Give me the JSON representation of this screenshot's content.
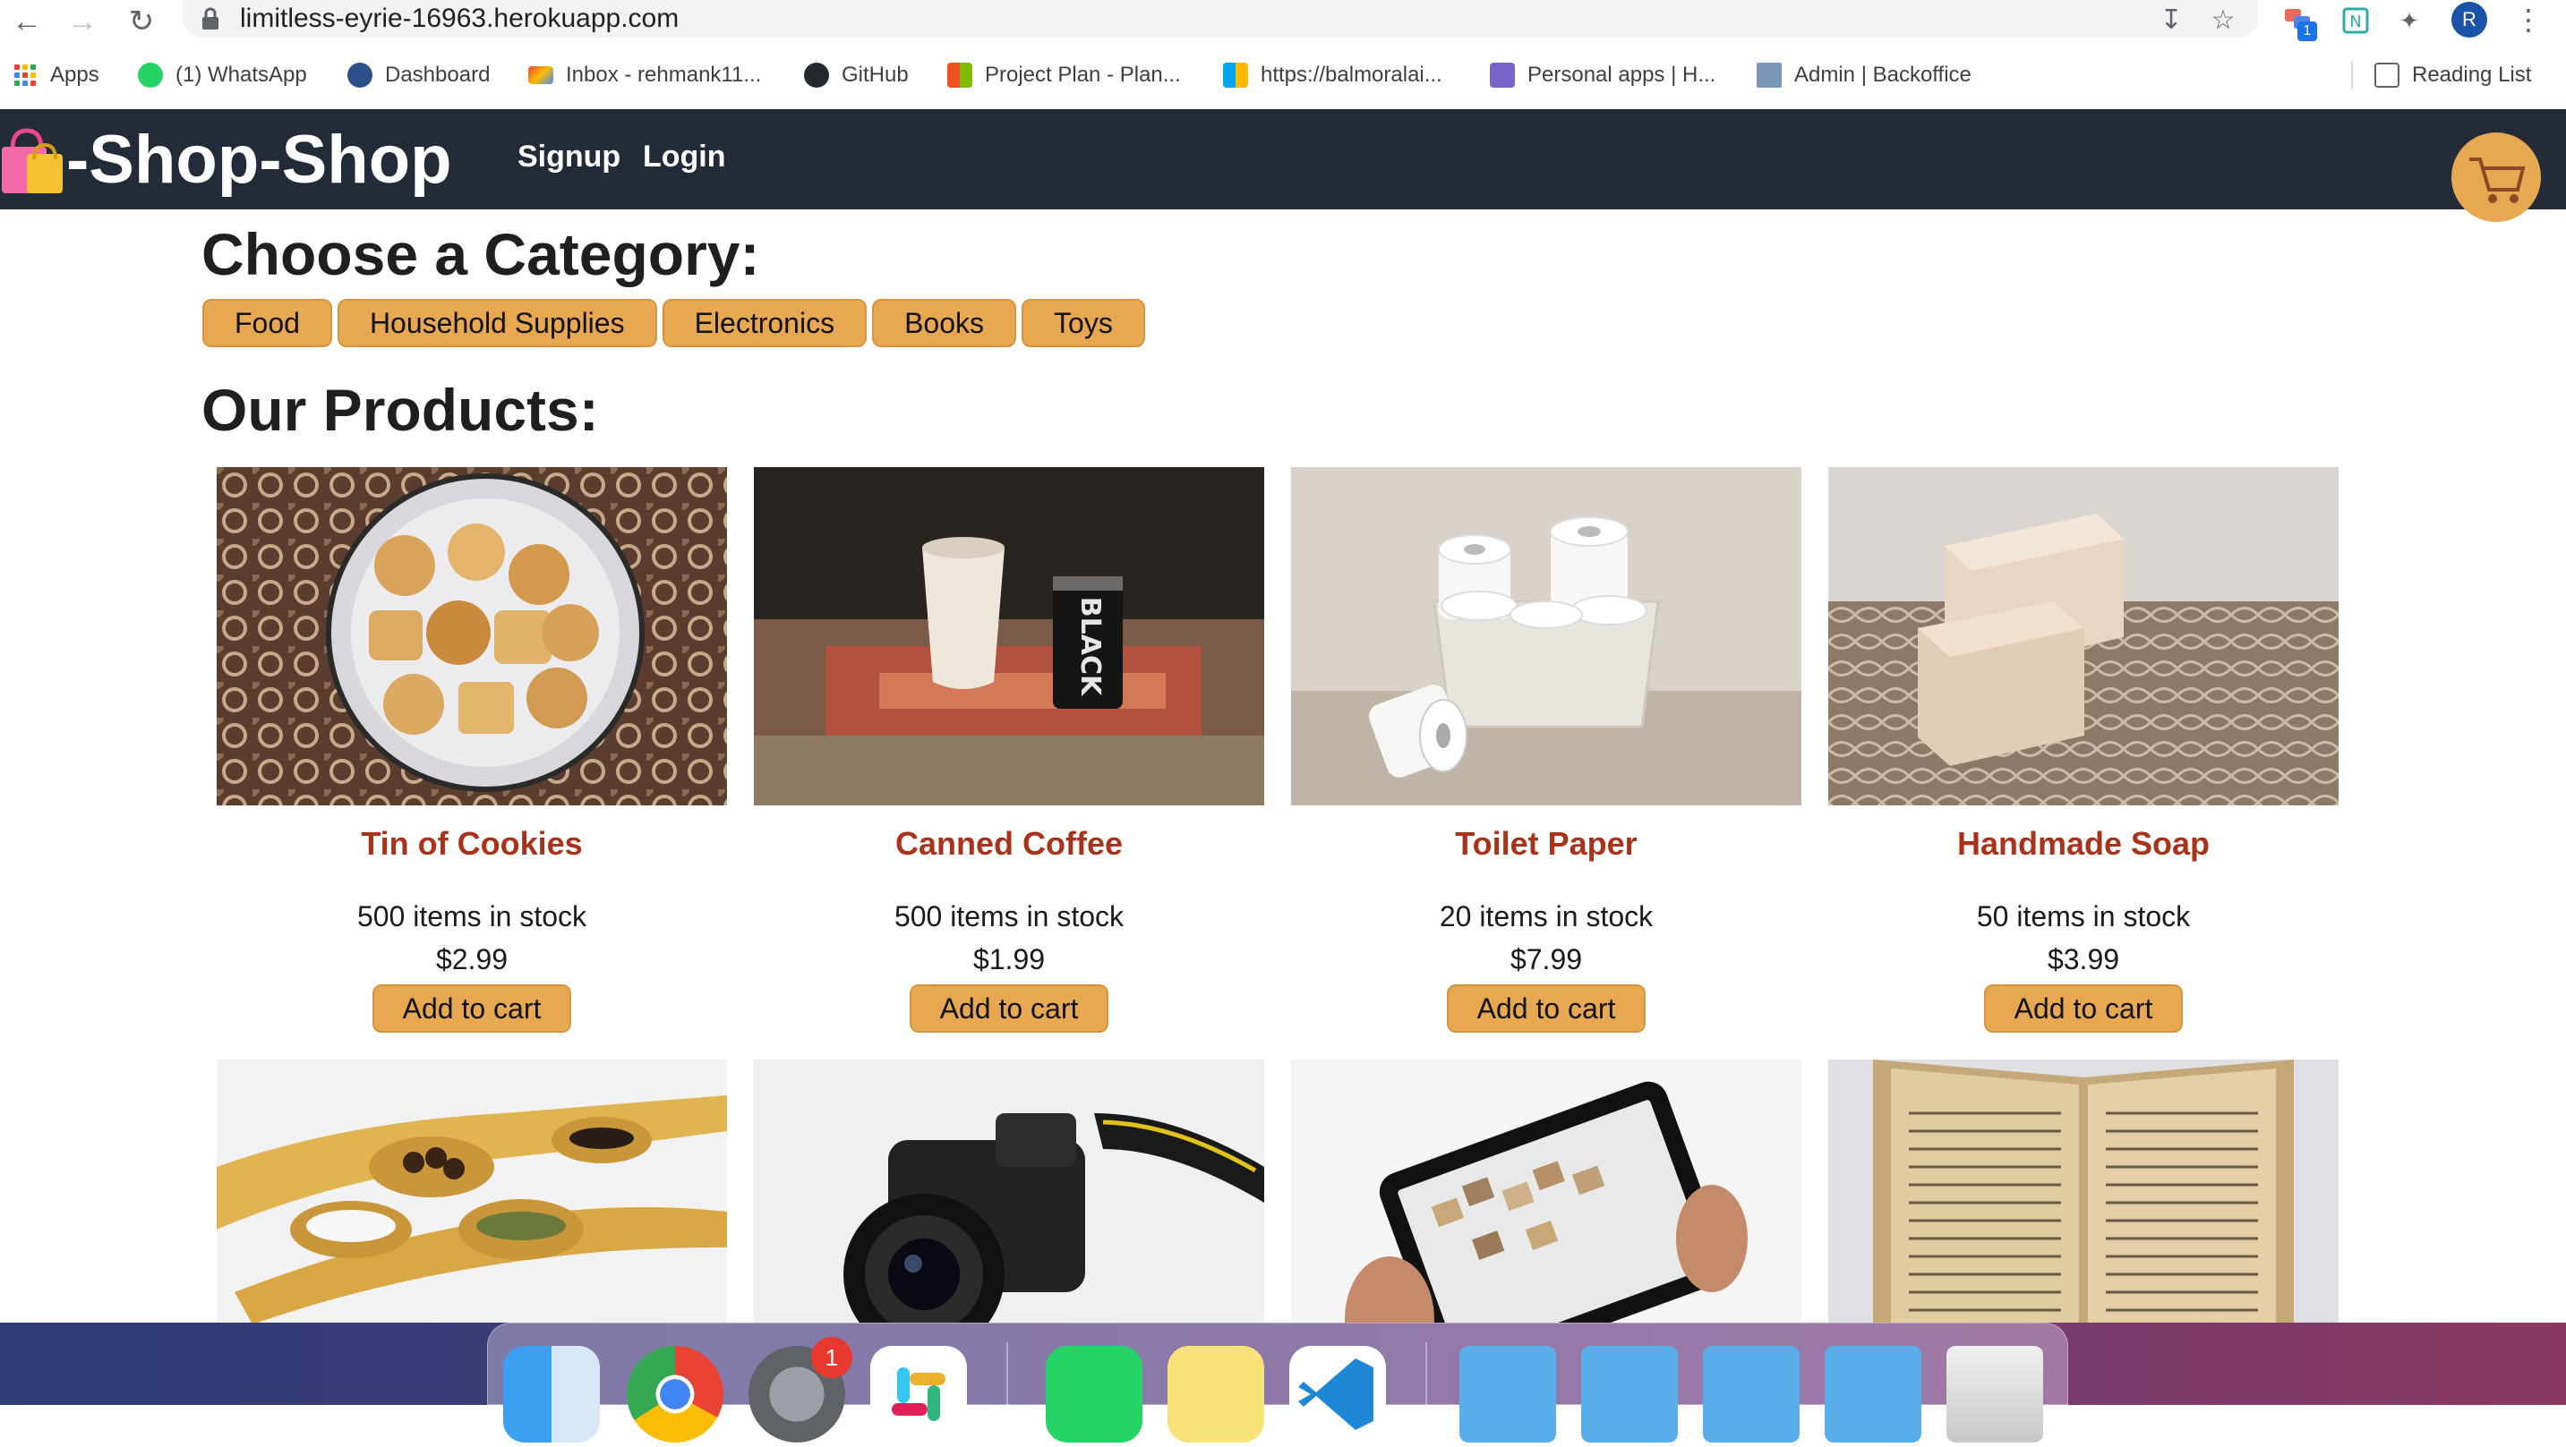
{
  "browser": {
    "url": "limitless-eyrie-16963.herokuapp.com",
    "profile_initial": "R",
    "extension_badge": "1",
    "bookmarks": [
      {
        "label": "Apps"
      },
      {
        "label": "(1) WhatsApp"
      },
      {
        "label": "Dashboard"
      },
      {
        "label": "Inbox - rehmank11..."
      },
      {
        "label": "GitHub"
      },
      {
        "label": "Project Plan - Plan..."
      },
      {
        "label": "https://balmoralai..."
      },
      {
        "label": "Personal apps | H..."
      },
      {
        "label": "Admin | Backoffice"
      }
    ],
    "reading_list": "Reading List"
  },
  "header": {
    "brand": "-Shop-Shop",
    "nav": [
      {
        "label": "Signup"
      },
      {
        "label": "Login"
      }
    ]
  },
  "categories_title": "Choose a Category:",
  "categories": [
    {
      "label": "Food"
    },
    {
      "label": "Household Supplies"
    },
    {
      "label": "Electronics"
    },
    {
      "label": "Books"
    },
    {
      "label": "Toys"
    }
  ],
  "products_title": "Our Products:",
  "products": [
    {
      "name": "Tin of Cookies",
      "stock": "500 items in stock",
      "price": "$2.99",
      "button": "Add to cart"
    },
    {
      "name": "Canned Coffee",
      "stock": "500 items in stock",
      "price": "$1.99",
      "button": "Add to cart"
    },
    {
      "name": "Toilet Paper",
      "stock": "20 items in stock",
      "price": "$7.99",
      "button": "Add to cart"
    },
    {
      "name": "Handmade Soap",
      "stock": "50 items in stock",
      "price": "$3.99",
      "button": "Add to cart"
    }
  ],
  "dock": {
    "notification_badge": "1"
  },
  "colors": {
    "header_bg": "#232b38",
    "accent": "#e8a852",
    "product_name": "#a8321a"
  },
  "icons": [
    "back-icon",
    "forward-icon",
    "reload-icon",
    "lock-icon",
    "install-icon",
    "star-icon",
    "extensions-icon",
    "menu-icon",
    "shopping-bag-icon",
    "cart-icon"
  ]
}
